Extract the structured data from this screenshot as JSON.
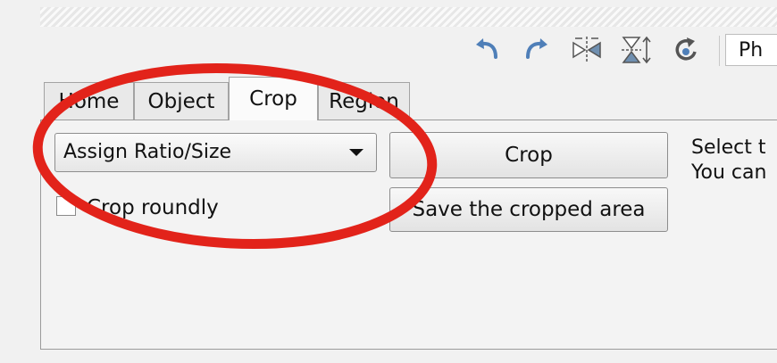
{
  "toolbar": {
    "icons": [
      {
        "name": "undo-icon"
      },
      {
        "name": "redo-icon"
      },
      {
        "name": "flip-horizontal-icon"
      },
      {
        "name": "flip-vertical-icon"
      },
      {
        "name": "rotate-icon"
      }
    ],
    "partial_label": "Ph"
  },
  "tabs": [
    {
      "label": "Home"
    },
    {
      "label": "Object"
    },
    {
      "label": "Crop",
      "active": true
    },
    {
      "label": "Region"
    }
  ],
  "crop_panel": {
    "ratio_select_value": "Assign Ratio/Size",
    "crop_button_label": "Crop",
    "save_button_label": "Save the cropped area",
    "crop_roundly_label": "Crop roundly",
    "crop_roundly_checked": false,
    "info_line_1": "Select t",
    "info_line_2": "You can"
  },
  "annotation": {
    "shape": "ellipse",
    "color": "#e2231a"
  }
}
